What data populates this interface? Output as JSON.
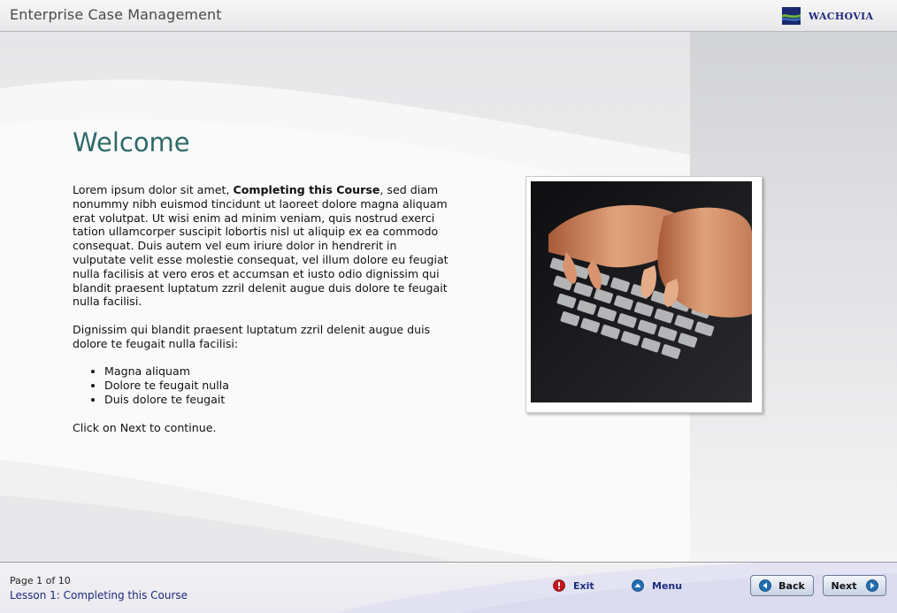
{
  "header": {
    "title": "Enterprise Case Management",
    "logo_text": "WACHOVIA"
  },
  "main": {
    "heading": "Welcome",
    "para1_pre": "Lorem ipsum dolor sit amet, ",
    "para1_bold": "Completing this Course",
    "para1_post": ", sed diam nonummy nibh euismod tincidunt ut laoreet dolore magna aliquam erat volutpat. Ut wisi enim ad minim veniam, quis nostrud exerci tation ullamcorper suscipit lobortis nisl ut aliquip ex ea commodo consequat. Duis autem vel eum iriure dolor in hendrerit in vulputate velit esse molestie consequat, vel illum dolore eu feugiat nulla facilisis at vero eros et accumsan et iusto odio dignissim qui blandit praesent luptatum zzril delenit augue duis dolore te feugait nulla facilisi.",
    "para2": "Dignissim qui blandit praesent luptatum zzril delenit augue duis dolore te feugait nulla facilisi:",
    "bullets": [
      "Magna aliquam",
      "Dolore te feugait nulla",
      "Duis dolore te feugait"
    ],
    "para3": "Click on Next to continue."
  },
  "footer": {
    "page_indicator": "Page 1 of 10",
    "lesson_title": "Lesson 1: Completing this Course",
    "exit_label": "Exit",
    "menu_label": "Menu",
    "back_label": "Back",
    "next_label": "Next"
  },
  "icons": {
    "exit": "exit-icon",
    "menu": "menu-icon",
    "back": "back-arrow-icon",
    "next": "next-arrow-icon"
  },
  "colors": {
    "heading": "#2f6a6a",
    "link": "#1e2e7e",
    "exit_icon": "#c0161b",
    "nav_icon": "#1f6fb1"
  }
}
